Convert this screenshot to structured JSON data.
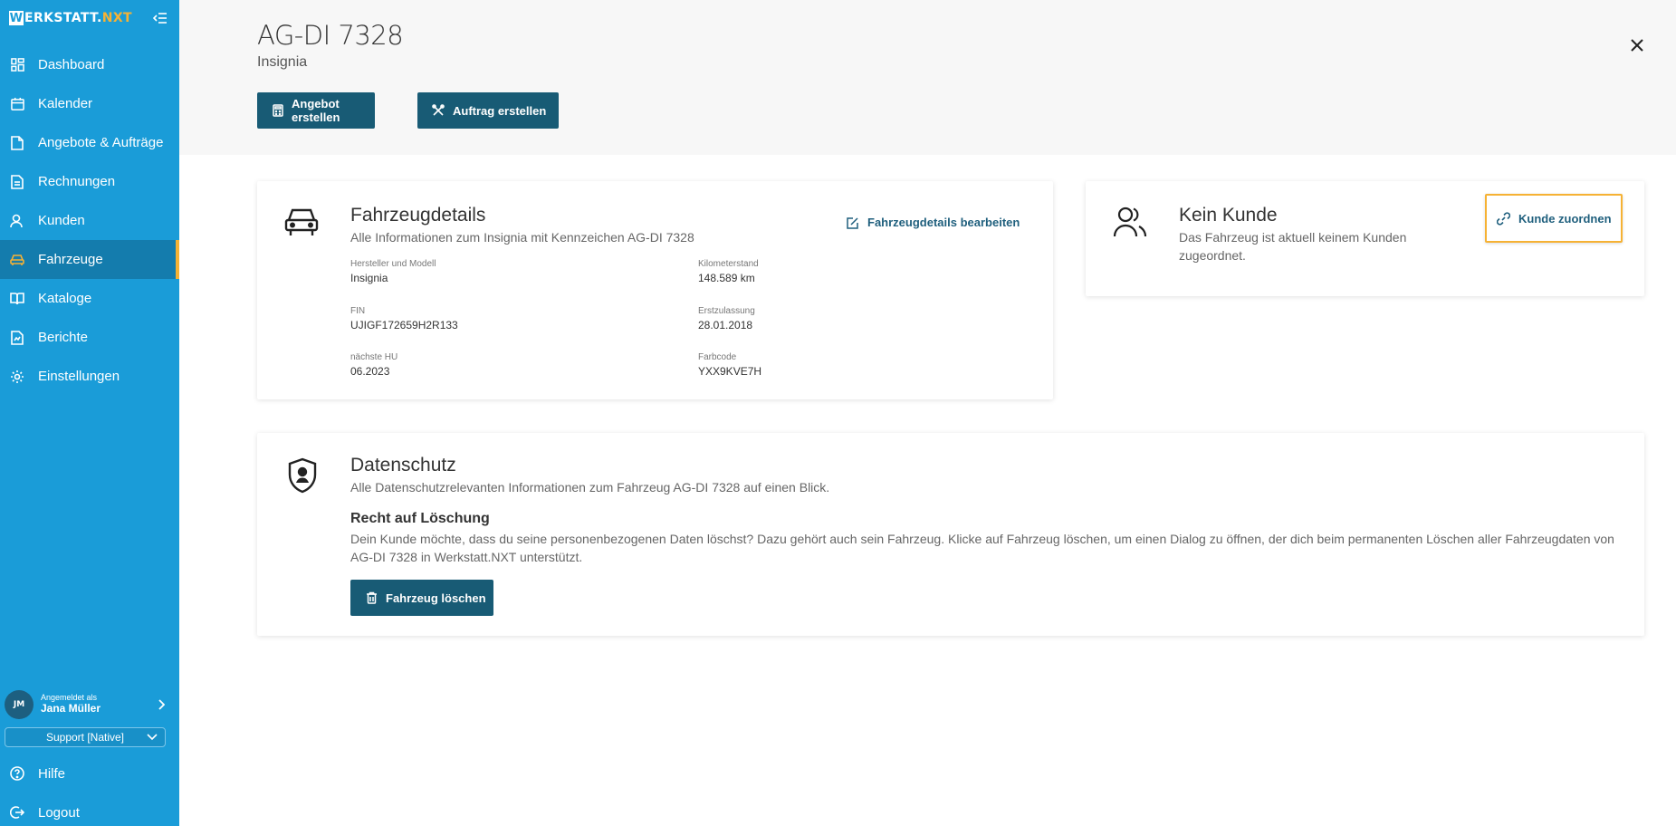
{
  "app": {
    "logo_w": "W",
    "logo_text": "ERKSTATT.",
    "logo_accent": "NXT"
  },
  "sidebar": {
    "items": [
      {
        "label": "Dashboard",
        "icon": "dashboard-icon"
      },
      {
        "label": "Kalender",
        "icon": "calendar-icon"
      },
      {
        "label": "Angebote & Aufträge",
        "icon": "document-icon"
      },
      {
        "label": "Rechnungen",
        "icon": "invoice-icon"
      },
      {
        "label": "Kunden",
        "icon": "user-icon"
      },
      {
        "label": "Fahrzeuge",
        "icon": "car-icon",
        "active": true
      },
      {
        "label": "Kataloge",
        "icon": "book-icon"
      },
      {
        "label": "Berichte",
        "icon": "report-icon"
      },
      {
        "label": "Einstellungen",
        "icon": "gear-icon"
      }
    ],
    "user": {
      "initials": "JM",
      "logged_in_as": "Angemeldet als",
      "name": "Jana Müller"
    },
    "support_select": "Support [Native]",
    "help_label": "Hilfe",
    "logout_label": "Logout"
  },
  "header": {
    "plate": "AG-DI 7328",
    "model": "Insignia",
    "btn_angebot": "Angebot erstellen",
    "btn_auftrag": "Auftrag erstellen"
  },
  "vehicle_card": {
    "title": "Fahrzeugdetails",
    "subtitle": "Alle Informationen zum Insignia mit Kennzeichen AG-DI 7328",
    "edit_label": "Fahrzeugdetails bearbeiten",
    "fields": [
      {
        "label": "Hersteller und Modell",
        "value": "Insignia"
      },
      {
        "label": "Kilometerstand",
        "value": "148.589 km"
      },
      {
        "label": "FIN",
        "value": "UJIGF172659H2R133"
      },
      {
        "label": "Erstzulassung",
        "value": "28.01.2018"
      },
      {
        "label": "nächste HU",
        "value": "06.2023"
      },
      {
        "label": "Farbcode",
        "value": "YXX9KVE7H"
      }
    ]
  },
  "customer_card": {
    "title": "Kein Kunde",
    "subtitle_line1": "Das Fahrzeug ist aktuell keinem Kunden",
    "subtitle_line2": "zugeordnet.",
    "assign_label": "Kunde zuordnen"
  },
  "privacy_card": {
    "title": "Datenschutz",
    "subtitle": "Alle Datenschutzrelevanten Informationen zum Fahrzeug AG-DI 7328 auf einen Blick.",
    "heading": "Recht auf Löschung",
    "text": "Dein Kunde möchte, dass du seine personenbezogenen Daten löschst? Dazu gehört auch sein Fahrzeug. Klicke auf Fahrzeug löschen, um einen Dialog zu öffnen, der dich beim permanenten Löschen aller Fahrzeugdaten von AG-DI 7328 in Werkstatt.NXT unterstützt.",
    "delete_label": "Fahrzeug löschen"
  },
  "colors": {
    "sidebar_bg": "#1a9cd8",
    "sidebar_active": "#147cad",
    "accent": "#f6b234",
    "button_dark": "#185b75"
  }
}
